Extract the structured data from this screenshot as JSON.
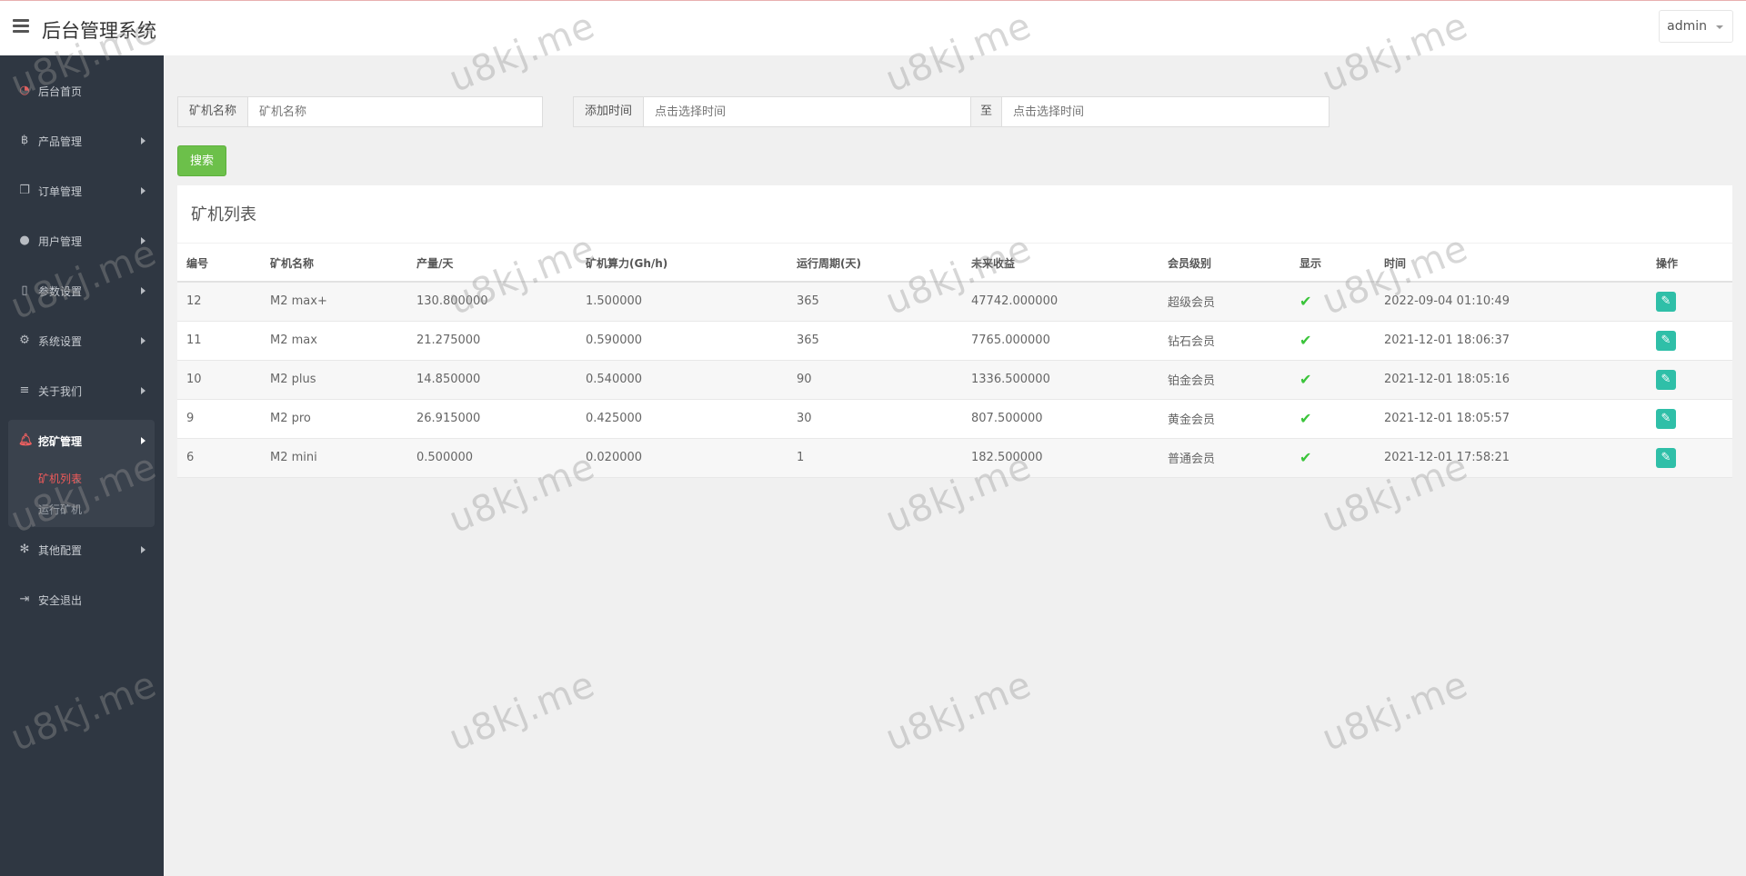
{
  "header": {
    "title": "后台管理系统",
    "user": "admin"
  },
  "sidebar": {
    "items": [
      {
        "label": "后台首页",
        "icon": "dashboard-icon"
      },
      {
        "label": "产品管理",
        "icon": "bitcoin-icon"
      },
      {
        "label": "订单管理",
        "icon": "copy-icon"
      },
      {
        "label": "用户管理",
        "icon": "user-icon"
      },
      {
        "label": "参数设置",
        "icon": "file-icon"
      },
      {
        "label": "系统设置",
        "icon": "cogs-icon"
      },
      {
        "label": "关于我们",
        "icon": "list-icon"
      },
      {
        "label": "挖矿管理",
        "icon": "bell-icon"
      },
      {
        "label": "其他配置",
        "icon": "gear-icon"
      },
      {
        "label": "安全退出",
        "icon": "signout-icon"
      }
    ],
    "sub_items": [
      {
        "label": "矿机列表"
      },
      {
        "label": "运行矿机"
      }
    ]
  },
  "filters": {
    "name_label": "矿机名称",
    "name_placeholder": "矿机名称",
    "time_label": "添加时间",
    "time_start_placeholder": "点击选择时间",
    "to_label": "至",
    "time_end_placeholder": "点击选择时间",
    "search_label": "搜索"
  },
  "panel": {
    "title": "矿机列表"
  },
  "table": {
    "headers": [
      "编号",
      "矿机名称",
      "产量/天",
      "矿机算力(Gh/h)",
      "运行周期(天)",
      "未来收益",
      "会员级别",
      "显示",
      "时间",
      "操作"
    ],
    "rows": [
      [
        "12",
        "M2 max+",
        "130.800000",
        "1.500000",
        "365",
        "47742.000000",
        "超级会员",
        "✔",
        "2022-09-04 01:10:49"
      ],
      [
        "11",
        "M2 max",
        "21.275000",
        "0.590000",
        "365",
        "7765.000000",
        "钻石会员",
        "✔",
        "2021-12-01 18:06:37"
      ],
      [
        "10",
        "M2 plus",
        "14.850000",
        "0.540000",
        "90",
        "1336.500000",
        "铂金会员",
        "✔",
        "2021-12-01 18:05:16"
      ],
      [
        "9",
        "M2 pro",
        "26.915000",
        "0.425000",
        "30",
        "807.500000",
        "黄金会员",
        "✔",
        "2021-12-01 18:05:57"
      ],
      [
        "6",
        "M2 mini",
        "0.500000",
        "0.020000",
        "1",
        "182.500000",
        "普通会员",
        "✔",
        "2021-12-01 17:58:21"
      ]
    ]
  },
  "watermark": "u8kj.me",
  "colors": {
    "sidebar_bg": "#2f3742",
    "accent_green": "#6cc04a",
    "edit_teal": "#2fbfa8",
    "active_red": "#f05a5a"
  }
}
